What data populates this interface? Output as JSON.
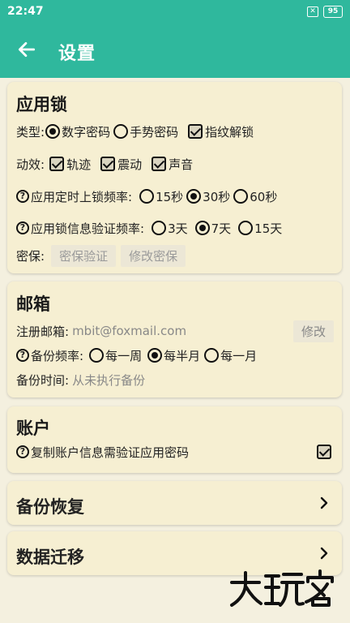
{
  "status_bar": {
    "time": "22:47",
    "battery": "95",
    "sim_icon": "sim-x-icon"
  },
  "app_bar": {
    "title": "设置",
    "back_icon": "arrow-left-icon"
  },
  "app_lock": {
    "title": "应用锁",
    "type": {
      "label": "类型:",
      "options": [
        {
          "label": "数字密码",
          "selected": true
        },
        {
          "label": "手势密码",
          "selected": false
        }
      ],
      "fingerprint": {
        "label": "指纹解锁",
        "checked": true
      }
    },
    "effects": {
      "label": "动效:",
      "items": [
        {
          "label": "轨迹",
          "checked": true
        },
        {
          "label": "震动",
          "checked": true
        },
        {
          "label": "声音",
          "checked": true
        }
      ]
    },
    "timed_lock": {
      "label": "应用定时上锁频率:",
      "options": [
        {
          "label": "15秒",
          "selected": false
        },
        {
          "label": "30秒",
          "selected": true
        },
        {
          "label": "60秒",
          "selected": false
        }
      ]
    },
    "verify_freq": {
      "label": "应用锁信息验证频率:",
      "options": [
        {
          "label": "3天",
          "selected": false
        },
        {
          "label": "7天",
          "selected": true
        },
        {
          "label": "15天",
          "selected": false
        }
      ]
    },
    "security": {
      "label": "密保:",
      "verify_button": "密保验证",
      "change_button": "修改密保"
    }
  },
  "email": {
    "title": "邮箱",
    "register": {
      "label": "注册邮箱:",
      "value": "mbit@foxmail.com",
      "edit_button": "修改"
    },
    "backup_freq": {
      "label": "备份频率:",
      "options": [
        {
          "label": "每一周",
          "selected": false
        },
        {
          "label": "每半月",
          "selected": true
        },
        {
          "label": "每一月",
          "selected": false
        }
      ]
    },
    "backup_time": {
      "label": "备份时间:",
      "value": "从未执行备份"
    }
  },
  "account": {
    "title": "账户",
    "copy_verify": {
      "label": "复制账户信息需验证应用密码",
      "checked": true
    }
  },
  "nav": [
    {
      "label": "备份恢复"
    },
    {
      "label": "数据迁移"
    }
  ],
  "watermark": {
    "logo": "大玩家"
  },
  "colors": {
    "accent": "#2fb89d",
    "background": "#f4f0df",
    "card": "#f6efd2"
  }
}
